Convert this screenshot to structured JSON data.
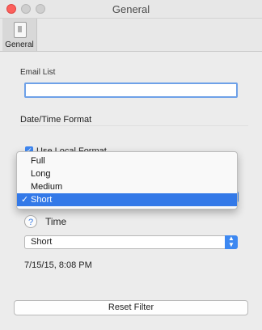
{
  "window": {
    "title": "General"
  },
  "toolbar": {
    "items": [
      {
        "label": "General",
        "icon": "switch-icon"
      }
    ]
  },
  "email_list": {
    "label": "Email List",
    "value": "",
    "placeholder": ""
  },
  "date_time_format": {
    "title": "Date/Time Format",
    "use_local_format": {
      "label": "Use Local Format",
      "checked": true
    },
    "date_menu": {
      "options": [
        "Full",
        "Long",
        "Medium",
        "Short"
      ],
      "selected": "Short",
      "check_mark": "✓"
    },
    "time": {
      "help_label": "?",
      "label": "Time",
      "selected": "Short"
    },
    "preview": "7/15/15, 8:08 PM"
  },
  "reset_button": {
    "label": "Reset Filter"
  },
  "colors": {
    "accent": "#3379e8",
    "window_bg": "#ececec"
  }
}
